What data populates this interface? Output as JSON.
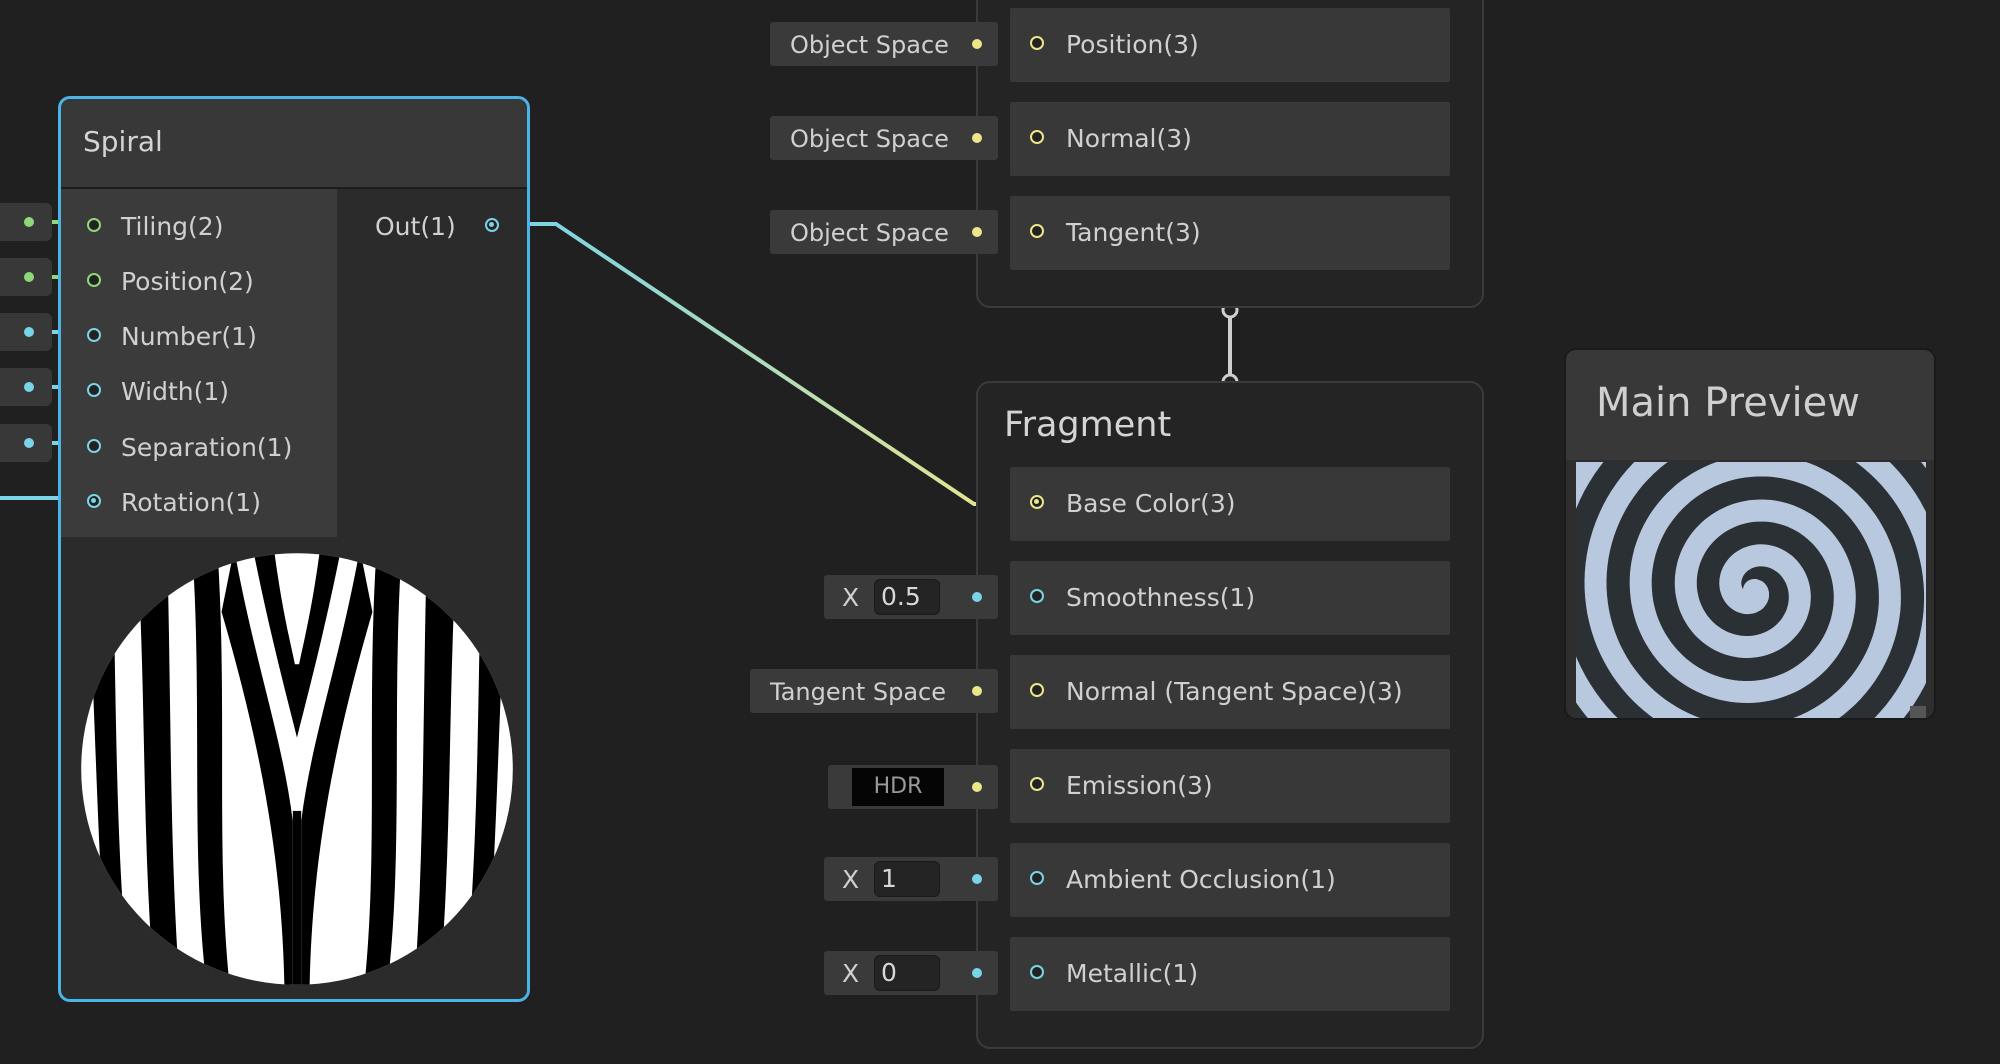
{
  "spiral_node": {
    "title": "Spiral",
    "inputs": [
      "Tiling(2)",
      "Position(2)",
      "Number(1)",
      "Width(1)",
      "Separation(1)",
      "Rotation(1)"
    ],
    "output": "Out(1)"
  },
  "vertex_block": {
    "fields": [
      "Object Space",
      "Object Space",
      "Object Space"
    ],
    "ports": [
      "Position(3)",
      "Normal(3)",
      "Tangent(3)"
    ]
  },
  "fragment_block": {
    "title": "Fragment",
    "ports": [
      "Base Color(3)",
      "Smoothness(1)",
      "Normal (Tangent Space)(3)",
      "Emission(3)",
      "Ambient Occlusion(1)",
      "Metallic(1)"
    ],
    "smoothness": {
      "axis": "X",
      "value": "0.5"
    },
    "normal_space": "Tangent Space",
    "emission_label": "HDR",
    "ambient_occlusion": {
      "axis": "X",
      "value": "1"
    },
    "metallic": {
      "axis": "X",
      "value": "0"
    }
  },
  "main_preview": {
    "title": "Main Preview"
  },
  "colors": {
    "background": "#202020",
    "selection": "#4ab4e8",
    "vector2_port": "#8fd87a",
    "float_port": "#7ad3e6",
    "vector3_port": "#ece68a"
  }
}
